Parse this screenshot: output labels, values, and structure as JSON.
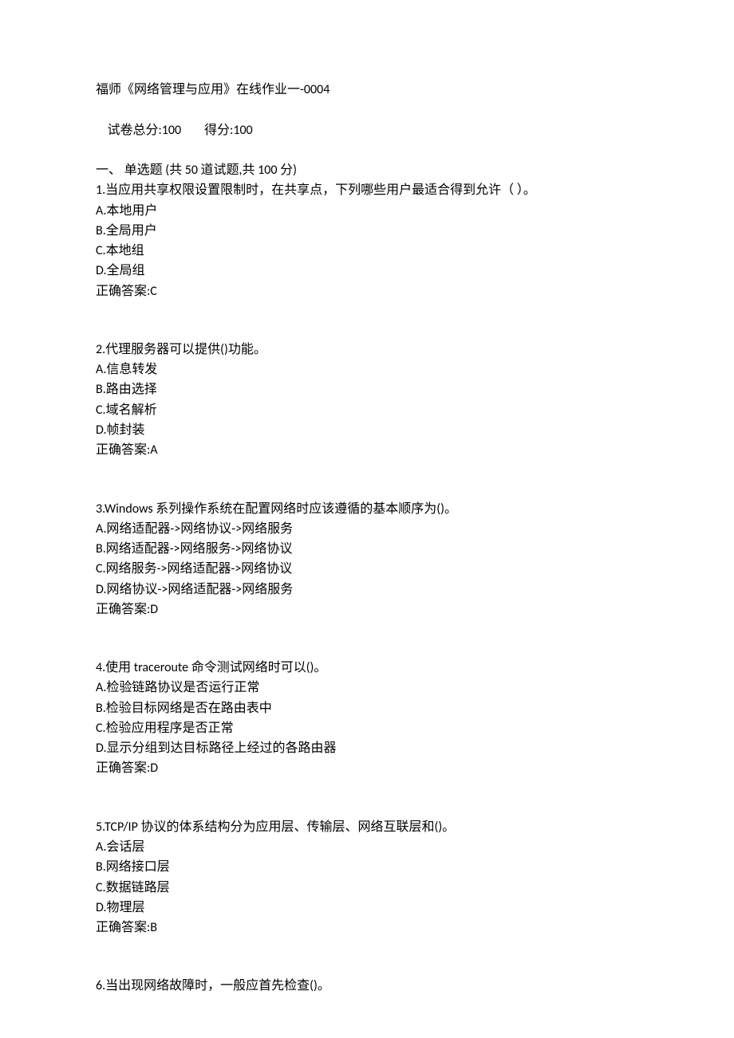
{
  "header": {
    "title": "福师《网络管理与应用》在线作业一-0004",
    "total_label": "试卷总分:",
    "total_value": "100",
    "score_label": "得分:",
    "score_value": "100",
    "section_label": "一、 单选题 (共 50 道试题,共 100 分)"
  },
  "answer_prefix": "正确答案:",
  "questions": [
    {
      "num": "1",
      "stem": "当应用共享权限设置限制时，在共享点，下列哪些用户最适合得到允许（ ）。",
      "options": [
        {
          "key": "A",
          "text": "本地用户"
        },
        {
          "key": "B",
          "text": "全局用户"
        },
        {
          "key": "C",
          "text": "本地组"
        },
        {
          "key": "D",
          "text": "全局组"
        }
      ],
      "answer": "C"
    },
    {
      "num": "2",
      "stem": "代理服务器可以提供()功能。",
      "options": [
        {
          "key": "A",
          "text": "信息转发"
        },
        {
          "key": "B",
          "text": "路由选择"
        },
        {
          "key": "C",
          "text": "域名解析"
        },
        {
          "key": "D",
          "text": "帧封装"
        }
      ],
      "answer": "A"
    },
    {
      "num": "3",
      "stem": "Windows 系列操作系统在配置网络时应该遵循的基本顺序为()。",
      "options": [
        {
          "key": "A",
          "text": "网络适配器->网络协议->网络服务"
        },
        {
          "key": "B",
          "text": "网络适配器->网络服务->网络协议"
        },
        {
          "key": "C",
          "text": "网络服务->网络适配器->网络协议"
        },
        {
          "key": "D",
          "text": "网络协议->网络适配器->网络服务"
        }
      ],
      "answer": "D"
    },
    {
      "num": "4",
      "stem": "使用 traceroute 命令测试网络时可以()。",
      "options": [
        {
          "key": "A",
          "text": "检验链路协议是否运行正常"
        },
        {
          "key": "B",
          "text": "检验目标网络是否在路由表中"
        },
        {
          "key": "C",
          "text": "检验应用程序是否正常"
        },
        {
          "key": "D",
          "text": "显示分组到达目标路径上经过的各路由器"
        }
      ],
      "answer": "D"
    },
    {
      "num": "5",
      "stem": "TCP/IP 协议的体系结构分为应用层、传输层、网络互联层和()。",
      "options": [
        {
          "key": "A",
          "text": "会话层"
        },
        {
          "key": "B",
          "text": "网络接口层"
        },
        {
          "key": "C",
          "text": "数据链路层"
        },
        {
          "key": "D",
          "text": "物理层"
        }
      ],
      "answer": "B"
    },
    {
      "num": "6",
      "stem": "当出现网络故障时，一般应首先检查()。",
      "options": [],
      "answer": ""
    }
  ]
}
